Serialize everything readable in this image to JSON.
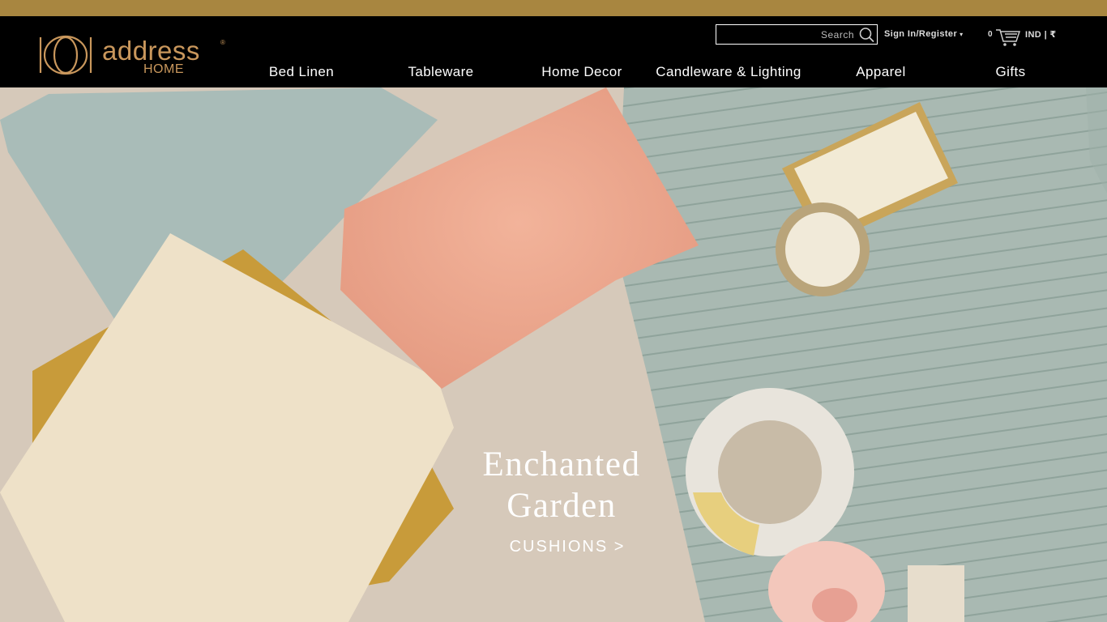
{
  "brand": {
    "name": "address",
    "sub": "HOME",
    "registered": "®"
  },
  "search": {
    "placeholder": "Search"
  },
  "account": {
    "signin_label": "Sign In/Register",
    "caret": "▾"
  },
  "cart": {
    "count": "0"
  },
  "currency": {
    "label": "IND | ₹"
  },
  "nav": {
    "items": [
      {
        "label": "Bed Linen"
      },
      {
        "label": "Tableware"
      },
      {
        "label": "Home Decor"
      },
      {
        "label": "Candleware & Lighting"
      },
      {
        "label": "Apparel"
      },
      {
        "label": "Gifts"
      }
    ]
  },
  "hero": {
    "title_line1": "Enchanted",
    "title_line2": "Garden",
    "link": "CUSHIONS >"
  },
  "colors": {
    "topbar": "#a88640",
    "header_bg": "#000000",
    "brand_gold": "#c9975c",
    "hero_bg": "#d5c8b9"
  }
}
